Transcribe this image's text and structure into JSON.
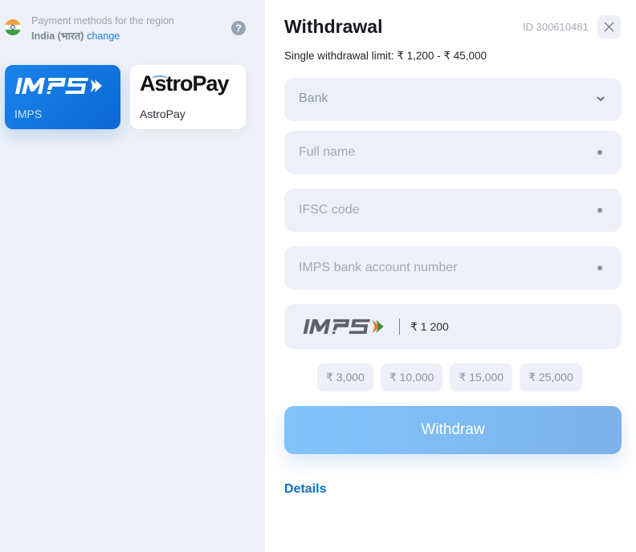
{
  "region": {
    "label": "Payment methods for the region",
    "country": "India (भारत)",
    "change_link": "change",
    "help": "?"
  },
  "methods": [
    {
      "name": "IMPS",
      "logo_text": "IMPS",
      "selected": true
    },
    {
      "name": "AstroPay",
      "logo_text": "AstroPay",
      "selected": false
    }
  ],
  "withdrawal": {
    "title": "Withdrawal",
    "id_label": "ID 300610481",
    "limit_text": "Single withdrawal limit: ₹ 1,200 - ₹ 45,000",
    "bank_placeholder": "Bank",
    "full_name_placeholder": "Full name",
    "ifsc_placeholder": "IFSC code",
    "account_placeholder": "IMPS bank account number",
    "amount_value": "₹ 1 200",
    "quick_amounts": [
      "₹ 3,000",
      "₹ 10,000",
      "₹ 15,000",
      "₹ 25,000"
    ],
    "submit_label": "Withdraw",
    "details_link": "Details"
  },
  "colors": {
    "accent": "#1a7fd6",
    "selected_method": "#0f72e0",
    "submit_button": "#80c4fb",
    "field_bg": "#edf0f8"
  }
}
